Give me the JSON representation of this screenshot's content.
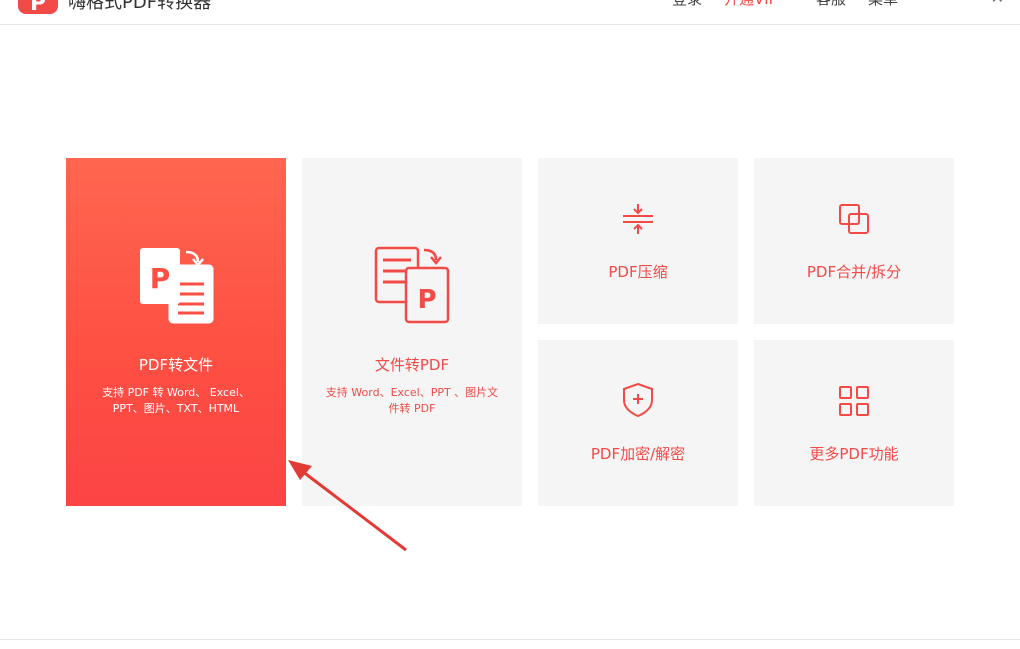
{
  "app": {
    "title": "嗨格式PDF转换器",
    "logo_glyph": "P",
    "brand_color": "#f24a46"
  },
  "topnav": {
    "login": "登录",
    "vip": "开通VIP",
    "service": "客服",
    "menu": "菜单",
    "close": "✕"
  },
  "features": {
    "pdf_to_file": {
      "title": "PDF转文件",
      "desc_line1": "支持 PDF 转 Word、 Excel、",
      "desc_line2": "PPT、图片、TXT、HTML",
      "icon": "pdf-to-file-icon"
    },
    "file_to_pdf": {
      "title": "文件转PDF",
      "desc_line1": "支持 Word、Excel、PPT 、图片文",
      "desc_line2": "件转 PDF",
      "icon": "file-to-pdf-icon"
    },
    "compress": {
      "title": "PDF压缩",
      "icon": "compress-icon"
    },
    "merge_split": {
      "title": "PDF合并/拆分",
      "icon": "merge-icon"
    },
    "encrypt": {
      "title": "PDF加密/解密",
      "icon": "shield-icon"
    },
    "more": {
      "title": "更多PDF功能",
      "icon": "grid-icon"
    }
  }
}
